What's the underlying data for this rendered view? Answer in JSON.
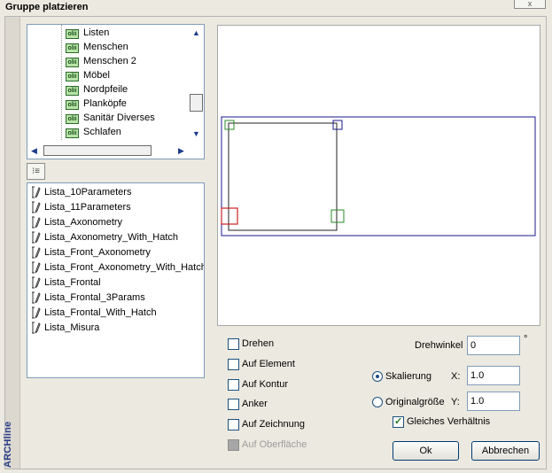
{
  "window": {
    "title": "Gruppe platzieren",
    "close_label": "x",
    "brand": "ARCHline"
  },
  "tree": {
    "items": [
      {
        "label": "Listen",
        "icon": "library-icon"
      },
      {
        "label": "Menschen",
        "icon": "library-icon"
      },
      {
        "label": "Menschen 2",
        "icon": "library-icon"
      },
      {
        "label": "Möbel",
        "icon": "library-icon"
      },
      {
        "label": "Nordpfeile",
        "icon": "library-icon"
      },
      {
        "label": "Planköpfe",
        "icon": "library-icon"
      },
      {
        "label": "Sanitär Diverses",
        "icon": "library-icon"
      },
      {
        "label": "Schlafen",
        "icon": "library-icon"
      }
    ],
    "icon_text": "olii",
    "scroll_up": "▲",
    "scroll_down": "▼",
    "scroll_left": "◀",
    "scroll_right": "▶"
  },
  "view_toggle": {
    "label": "⁝≡"
  },
  "list": {
    "items": [
      "Lista_10Parameters",
      "Lista_11Parameters",
      "Lista_Axonometry",
      "Lista_Axonometry_With_Hatch",
      "Lista_Front_Axonometry",
      "Lista_Front_Axonometry_With_Hatch",
      "Lista_Frontal",
      "Lista_Frontal_3Params",
      "Lista_Frontal_With_Hatch",
      "Lista_Misura"
    ],
    "icon": "symbol-pen-icon"
  },
  "options": {
    "drehen": {
      "label": "Drehen",
      "checked": false
    },
    "auf_element": {
      "label": "Auf Element",
      "checked": false
    },
    "auf_kontur": {
      "label": "Auf Kontur",
      "checked": false
    },
    "anker": {
      "label": "Anker",
      "checked": false
    },
    "auf_zeichnung": {
      "label": "Auf Zeichnung",
      "checked": false
    },
    "auf_oberflaeche": {
      "label": "Auf Oberfläche",
      "checked": false,
      "disabled": true
    }
  },
  "rotation": {
    "label": "Drehwinkel",
    "value": "0",
    "unit": "°"
  },
  "scaling": {
    "skalierung": {
      "label": "Skalierung",
      "selected": true
    },
    "originalgroesse": {
      "label": "Originalgröße",
      "selected": false
    },
    "x_label": "X:",
    "x_value": "1.0",
    "y_label": "Y:",
    "y_value": "1.0",
    "keep_ratio": {
      "label": "Gleiches Verhältnis",
      "checked": true
    }
  },
  "buttons": {
    "ok": "Ok",
    "cancel": "Abbrechen"
  },
  "colors": {
    "accent": "#1c5180",
    "preview_outline": "#1a1a8c",
    "handle_green": "#2a8a2a",
    "handle_red": "#cc2222"
  }
}
